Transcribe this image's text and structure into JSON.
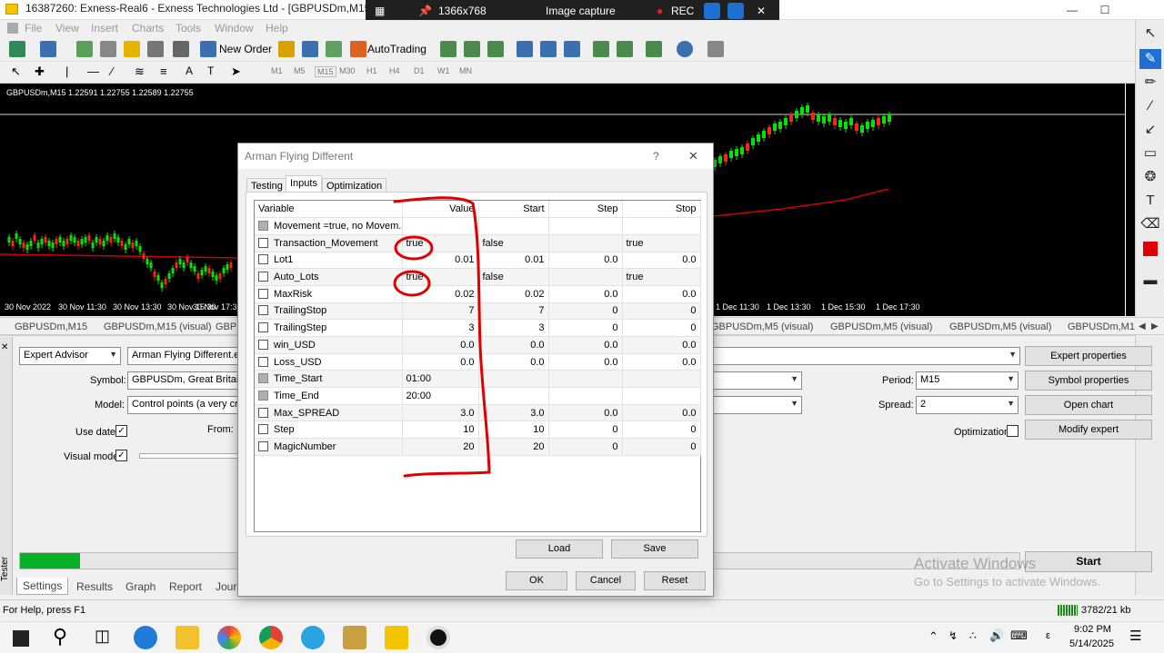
{
  "window": {
    "title": "16387260: Exness-Real6 - Exness Technologies Ltd - [GBPUSDm,M15 (visual)]"
  },
  "capture_bar": {
    "resolution": "1366x768",
    "label": "Image capture",
    "rec": "REC"
  },
  "menu": [
    "File",
    "View",
    "Insert",
    "Charts",
    "Tools",
    "Window",
    "Help"
  ],
  "toolbar": {
    "new_order": "New Order",
    "autotrading": "AutoTrading",
    "timeframes": [
      "M1",
      "M5",
      "M15",
      "M30",
      "H1",
      "H4",
      "D1",
      "W1",
      "MN"
    ]
  },
  "chart": {
    "symbol_line": "GBPUSDm,M15  1.22591 1.22755 1.22589 1.22755",
    "x_labels": [
      "30 Nov 2022",
      "30 Nov 11:30",
      "30 Nov 13:30",
      "30 Nov 15:30",
      "30 Nov 17:30",
      "1 Dec 11:30",
      "1 Dec 13:30",
      "1 Dec 15:30",
      "1 Dec 17:30"
    ],
    "colors": {
      "bull": "#00e600",
      "bear": "#ff2020",
      "ma": "#d00000"
    }
  },
  "chart_tabs": [
    "GBPUSDm,M15",
    "GBPUSDm,M15 (visual)",
    "GBP",
    "GBPUSDm,M5 (visual)",
    "GBPUSDm,M5 (visual)",
    "GBPUSDm,M5 (visual)",
    "GBPUSDm,M1"
  ],
  "tester": {
    "side_label": "Tester",
    "type": "Expert Advisor",
    "ea_file": "Arman Flying Different.ex4",
    "symbol_label": "Symbol:",
    "symbol_value": "GBPUSDm, Great Britain P",
    "model_label": "Model:",
    "model_value": "Control points (a very crude",
    "use_date": "Use date",
    "from": "From:",
    "visual_mode": "Visual mode",
    "period_label": "Period:",
    "period_value": "M15",
    "spread_label": "Spread:",
    "spread_value": "2",
    "optimization": "Optimization",
    "expert_properties": "Expert properties",
    "symbol_properties": "Symbol properties",
    "open_chart": "Open chart",
    "modify_expert": "Modify expert",
    "start": "Start",
    "progress_pct": 6,
    "tabs": [
      "Settings",
      "Results",
      "Graph",
      "Report",
      "Journ"
    ]
  },
  "watermark": {
    "line1": "Activate Windows",
    "line2": "Go to Settings to activate Windows."
  },
  "status": {
    "help": "For Help, press F1",
    "traffic": "3782/21 kb"
  },
  "taskbar": {
    "time": "9:02 PM",
    "date": "5/14/2025"
  },
  "dialog": {
    "title": "Arman Flying Different",
    "help": "?",
    "close": "✕",
    "tabs": [
      "Testing",
      "Inputs",
      "Optimization"
    ],
    "columns": [
      "Variable",
      "Value",
      "Start",
      "Step",
      "Stop"
    ],
    "rows": [
      {
        "name": "Movement =true, no Movem...",
        "value": "",
        "start": "",
        "step": "",
        "stop": "",
        "header": true
      },
      {
        "name": "Transaction_Movement",
        "value": "true",
        "start": "false",
        "step": "",
        "stop": "true"
      },
      {
        "name": "Lot1",
        "value": "0.01",
        "start": "0.01",
        "step": "0.0",
        "stop": "0.0"
      },
      {
        "name": "Auto_Lots",
        "value": "true",
        "start": "false",
        "step": "",
        "stop": "true"
      },
      {
        "name": "MaxRisk",
        "value": "0.02",
        "start": "0.02",
        "step": "0.0",
        "stop": "0.0"
      },
      {
        "name": "TrailingStop",
        "value": "7",
        "start": "7",
        "step": "0",
        "stop": "0"
      },
      {
        "name": "TrailingStep",
        "value": "3",
        "start": "3",
        "step": "0",
        "stop": "0"
      },
      {
        "name": "win_USD",
        "value": "0.0",
        "start": "0.0",
        "step": "0.0",
        "stop": "0.0"
      },
      {
        "name": "Loss_USD",
        "value": "0.0",
        "start": "0.0",
        "step": "0.0",
        "stop": "0.0"
      },
      {
        "name": "Time_Start",
        "value": "01:00",
        "start": "",
        "step": "",
        "stop": "",
        "gray": true
      },
      {
        "name": "Time_End",
        "value": "20:00",
        "start": "",
        "step": "",
        "stop": "",
        "gray": true
      },
      {
        "name": "Max_SPREAD",
        "value": "3.0",
        "start": "3.0",
        "step": "0.0",
        "stop": "0.0"
      },
      {
        "name": "Step",
        "value": "10",
        "start": "10",
        "step": "0",
        "stop": "0"
      },
      {
        "name": "MagicNumber",
        "value": "20",
        "start": "20",
        "step": "0",
        "stop": "0"
      }
    ],
    "load": "Load",
    "save": "Save",
    "ok": "OK",
    "cancel": "Cancel",
    "reset": "Reset"
  }
}
